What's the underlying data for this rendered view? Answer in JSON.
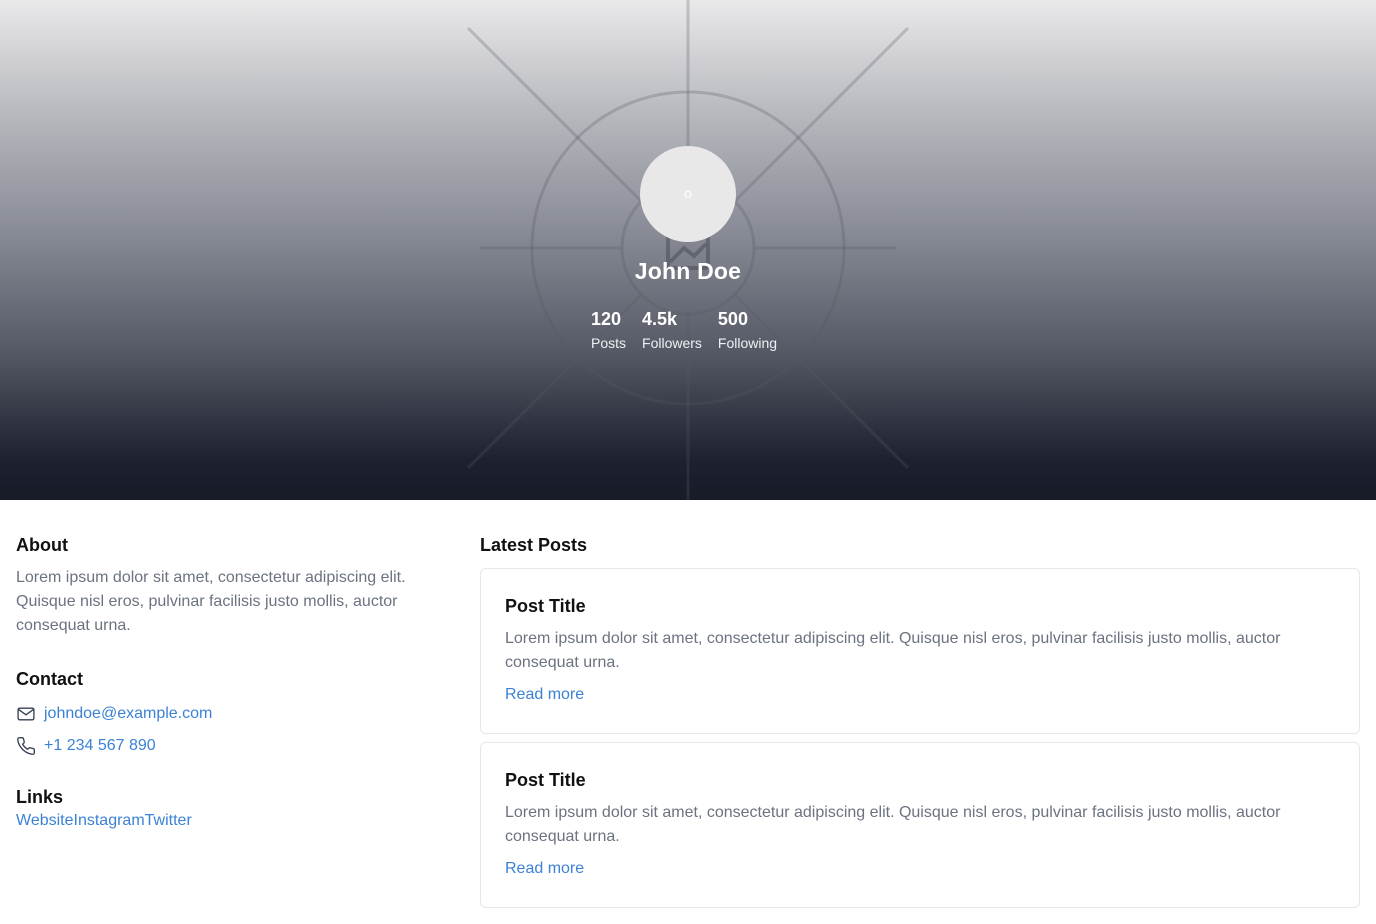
{
  "profile": {
    "name": "John Doe",
    "stats": [
      {
        "value": "120",
        "label": "Posts"
      },
      {
        "value": "4.5k",
        "label": "Followers"
      },
      {
        "value": "500",
        "label": "Following"
      }
    ]
  },
  "about": {
    "title": "About",
    "text": "Lorem ipsum dolor sit amet, consectetur adipiscing elit. Quisque nisl eros, pulvinar facilisis justo mollis, auctor consequat urna."
  },
  "contact": {
    "title": "Contact",
    "email": "johndoe@example.com",
    "phone": "+1 234 567 890",
    "email_icon": "mail-icon",
    "phone_icon": "phone-icon"
  },
  "links": {
    "title": "Links",
    "items": [
      "Website",
      "Instagram",
      "Twitter"
    ]
  },
  "posts": {
    "title": "Latest Posts",
    "items": [
      {
        "title": "Post Title",
        "body": "Lorem ipsum dolor sit amet, consectetur adipiscing elit. Quisque nisl eros, pulvinar facilisis justo mollis, auctor consequat urna.",
        "link": "Read more"
      },
      {
        "title": "Post Title",
        "body": "Lorem ipsum dolor sit amet, consectetur adipiscing elit. Quisque nisl eros, pulvinar facilisis justo mollis, auctor consequat urna.",
        "link": "Read more"
      }
    ]
  },
  "colors": {
    "link": "#3b82d6",
    "muted_text": "#6b7280",
    "hero_top": "#e9e9ea",
    "hero_bottom": "#171b28"
  }
}
